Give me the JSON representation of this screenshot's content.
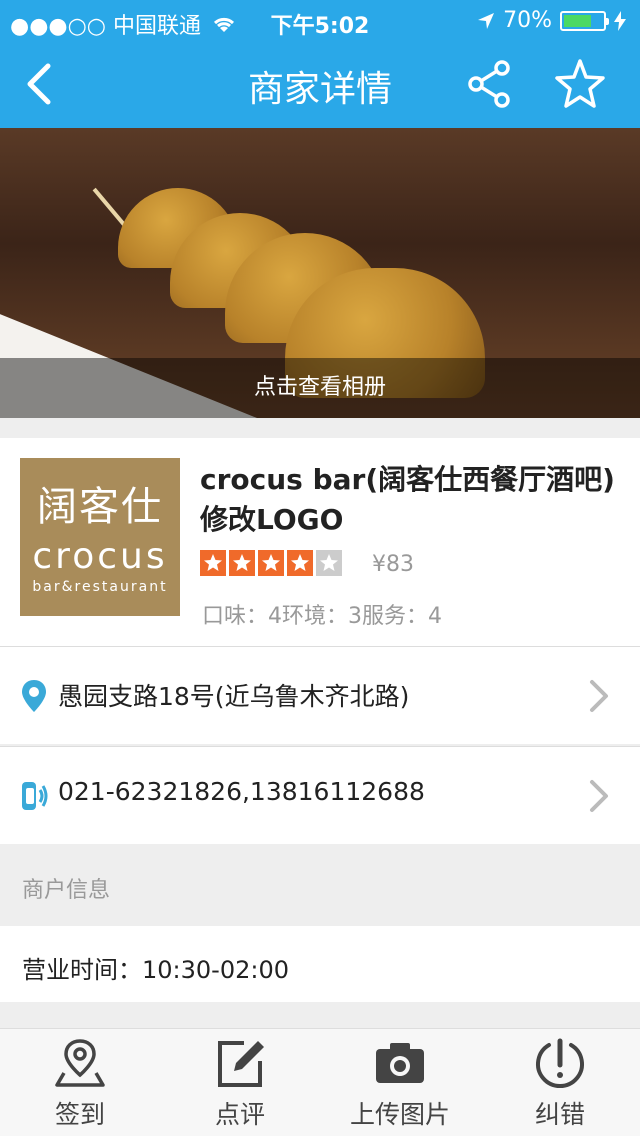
{
  "status_bar": {
    "carrier": "●●●○○ 中国联通",
    "time": "下午5:02",
    "battery": "70%",
    "battery_level": 0.7
  },
  "nav": {
    "title": "商家详情",
    "back_icon": "chevron-left-icon",
    "share_icon": "share-icon",
    "favorite_icon": "star-outline-icon"
  },
  "hero": {
    "caption": "点击查看相册"
  },
  "merchant": {
    "logo_line1": "阔客仕",
    "logo_line2": "crocus",
    "logo_line3": "bar&restaurant",
    "name": "crocus bar(阔客仕西餐厅酒吧)  修改LOGO",
    "rating": 4,
    "rating_max": 5,
    "price": "¥83",
    "scores": "口味：4环境：3服务：4",
    "accent_color": "#f06a2a"
  },
  "address": {
    "text": "愚园支路18号(近乌鲁木齐北路)",
    "icon": "location-pin-icon"
  },
  "phone": {
    "text": "021-62321826,13816112688",
    "icon": "phone-icon"
  },
  "info": {
    "section_title": "商户信息",
    "hours": "营业时间：10:30-02:00"
  },
  "tabs": [
    {
      "label": "签到",
      "icon": "checkin-pin-icon"
    },
    {
      "label": "点评",
      "icon": "edit-icon"
    },
    {
      "label": "上传图片",
      "icon": "camera-icon"
    },
    {
      "label": "纠错",
      "icon": "error-report-icon"
    }
  ],
  "colors": {
    "primary": "#2aa8e8",
    "background": "#eeeeee"
  }
}
